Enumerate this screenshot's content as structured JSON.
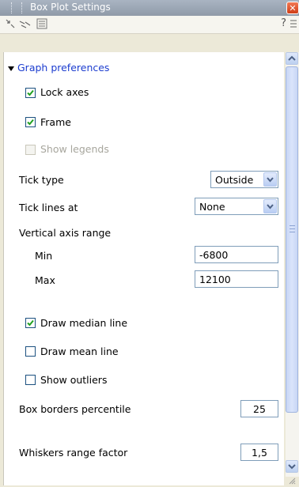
{
  "window": {
    "title": "Box Plot Settings"
  },
  "section": {
    "title": "Graph preferences"
  },
  "checkboxes": {
    "lock_axes": {
      "label": "Lock axes",
      "checked": true
    },
    "frame": {
      "label": "Frame",
      "checked": true
    },
    "show_legends": {
      "label": "Show legends",
      "checked": false,
      "disabled": true
    },
    "draw_median": {
      "label": "Draw median line",
      "checked": true
    },
    "draw_mean": {
      "label": "Draw mean line",
      "checked": false
    },
    "show_outliers": {
      "label": "Show outliers",
      "checked": false
    }
  },
  "tick_type": {
    "label": "Tick type",
    "value": "Outside"
  },
  "tick_lines": {
    "label": "Tick lines at",
    "value": "None"
  },
  "vertical_axis": {
    "label": "Vertical axis range",
    "min_label": "Min",
    "min_value": "-6800",
    "max_label": "Max",
    "max_value": "12100"
  },
  "box_borders": {
    "label": "Box borders percentile",
    "value": "25"
  },
  "whiskers": {
    "label": "Whiskers range factor",
    "value": "1,5"
  },
  "help": {
    "glyph": "?"
  },
  "colors": {
    "accent": "#1b3ccf",
    "titlebar": "#9aa5b3",
    "close": "#d9481f"
  }
}
